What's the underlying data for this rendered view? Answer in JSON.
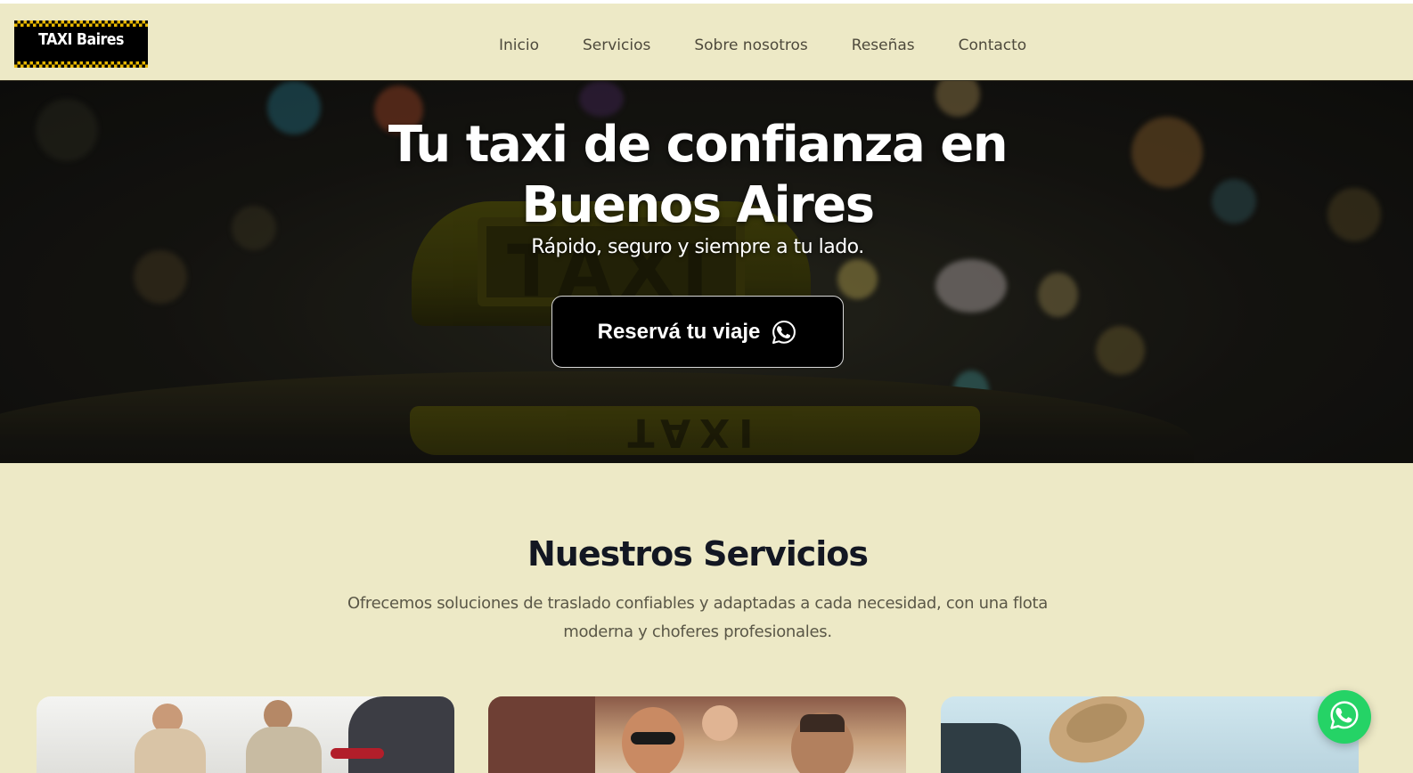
{
  "brand": {
    "logo_text": "TAXI Baires",
    "accent_yellow": "#e8b800"
  },
  "nav": {
    "items": [
      {
        "label": "Inicio"
      },
      {
        "label": "Servicios"
      },
      {
        "label": "Sobre nosotros"
      },
      {
        "label": "Reseñas"
      },
      {
        "label": "Contacto"
      }
    ]
  },
  "hero": {
    "title_line1": "Tu taxi de confianza en",
    "title_line2": "Buenos Aires",
    "subtitle": "Rápido, seguro y siempre a tu lado.",
    "cta_label": "Reservá tu viaje",
    "cta_icon": "whatsapp-icon",
    "background_sign_text": "TAXI"
  },
  "services": {
    "title": "Nuestros Servicios",
    "description": "Ofrecemos soluciones de traslado confiables y adaptadas a cada necesidad, con una flota moderna y choferes profesionales."
  },
  "floating_button": {
    "icon": "whatsapp-icon",
    "color": "#25d366"
  },
  "colors": {
    "page_background": "#ede9c6",
    "heading": "#131722",
    "button": "#000000"
  }
}
